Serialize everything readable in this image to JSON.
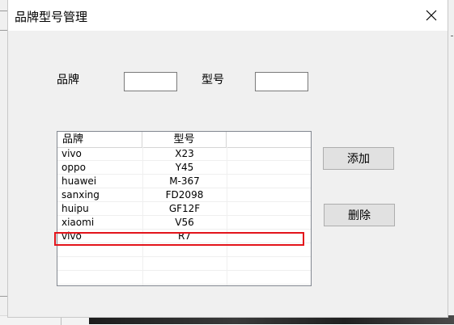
{
  "window": {
    "title": "品牌型号管理"
  },
  "form": {
    "brand_label": "品牌",
    "model_label": "型号",
    "brand_value": "",
    "model_value": ""
  },
  "table": {
    "columns": [
      "品牌",
      "型号"
    ],
    "rows": [
      {
        "brand": "vivo",
        "model": "X23"
      },
      {
        "brand": "oppo",
        "model": "Y45"
      },
      {
        "brand": "huawei",
        "model": "M-367"
      },
      {
        "brand": "sanxing",
        "model": "FD2098"
      },
      {
        "brand": "huipu",
        "model": "GF12F"
      },
      {
        "brand": "xiaomi",
        "model": "V56"
      },
      {
        "brand": "vivo",
        "model": "R7"
      }
    ],
    "highlighted_row_index": 6,
    "highlight_color": "#e3141b"
  },
  "buttons": {
    "add_label": "添加",
    "delete_label": "删除"
  },
  "icons": {
    "close": "close-icon"
  }
}
